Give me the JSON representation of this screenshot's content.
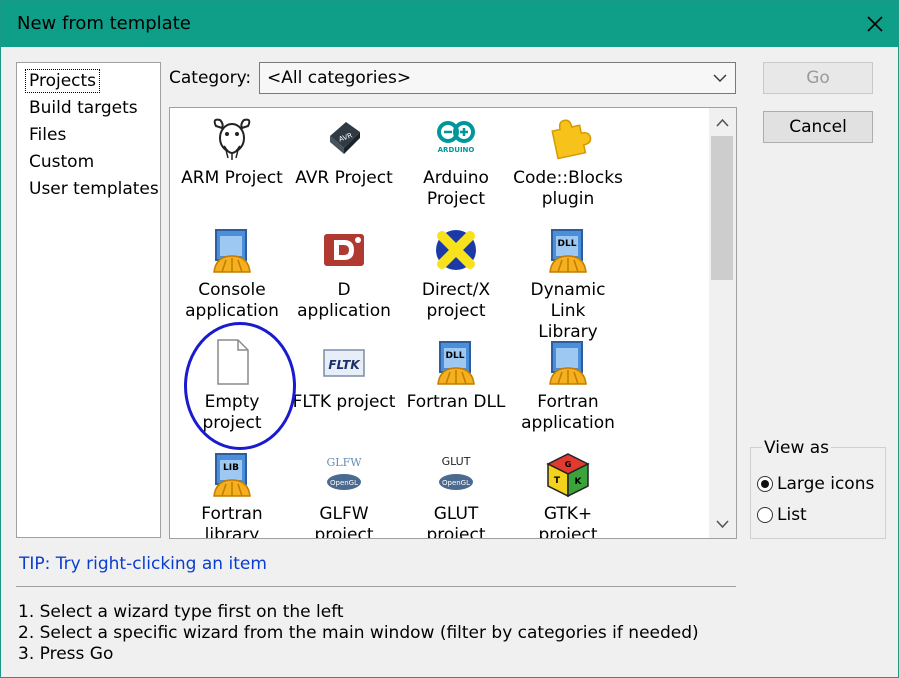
{
  "window": {
    "title": "New from template"
  },
  "left_list": {
    "items": [
      {
        "label": "Projects",
        "selected": true
      },
      {
        "label": "Build targets"
      },
      {
        "label": "Files"
      },
      {
        "label": "Custom"
      },
      {
        "label": "User templates"
      }
    ]
  },
  "category": {
    "label": "Category:",
    "value": "<All categories>"
  },
  "buttons": {
    "go": "Go",
    "cancel": "Cancel"
  },
  "grid": {
    "items": [
      {
        "label": "ARM Project",
        "icon": "gnu-head-icon"
      },
      {
        "label": "AVR Project",
        "icon": "avr-chip-icon"
      },
      {
        "label": "Arduino\nProject",
        "icon": "arduino-icon",
        "icon_text": "ARDUINO"
      },
      {
        "label": "Code::Blocks\nplugin",
        "icon": "puzzle-piece-icon"
      },
      {
        "label": "Console\napplication",
        "icon": "console-app-icon"
      },
      {
        "label": "D application",
        "icon": "d-language-icon"
      },
      {
        "label": "Direct/X\nproject",
        "icon": "directx-icon"
      },
      {
        "label": "Dynamic Link\nLibrary",
        "icon": "dll-icon",
        "icon_text": "DLL"
      },
      {
        "label": "Empty\nproject",
        "icon": "blank-document-icon"
      },
      {
        "label": "FLTK project",
        "icon": "fltk-icon",
        "icon_text": "FLTK"
      },
      {
        "label": "Fortran DLL",
        "icon": "fortran-dll-icon",
        "icon_text": "DLL"
      },
      {
        "label": "Fortran\napplication",
        "icon": "fortran-app-icon"
      },
      {
        "label": "Fortran\nlibrary",
        "icon": "fortran-lib-icon",
        "icon_text": "LIB"
      },
      {
        "label": "GLFW\nproject",
        "icon": "glfw-icon",
        "icon_text": "GLFW",
        "icon_subtext": "OpenGL"
      },
      {
        "label": "GLUT\nproject",
        "icon": "glut-icon",
        "icon_text": "GLUT",
        "icon_subtext": "OpenGL"
      },
      {
        "label": "GTK+\nproject",
        "icon": "gtk-cube-icon",
        "icon_text": "GTK"
      }
    ]
  },
  "view_as": {
    "title": "View as",
    "options": [
      {
        "label": "Large icons",
        "checked": true
      },
      {
        "label": "List",
        "checked": false
      }
    ]
  },
  "tip": "TIP: Try right-clicking an item",
  "instructions": [
    "1. Select a wizard type first on the left",
    "2. Select a specific wizard from the main window (filter by categories if needed)",
    "3. Press Go"
  ],
  "colors": {
    "titlebar": "#0f9e88",
    "tip_text": "#0a3cd0",
    "annotation": "#1a1ad0"
  }
}
